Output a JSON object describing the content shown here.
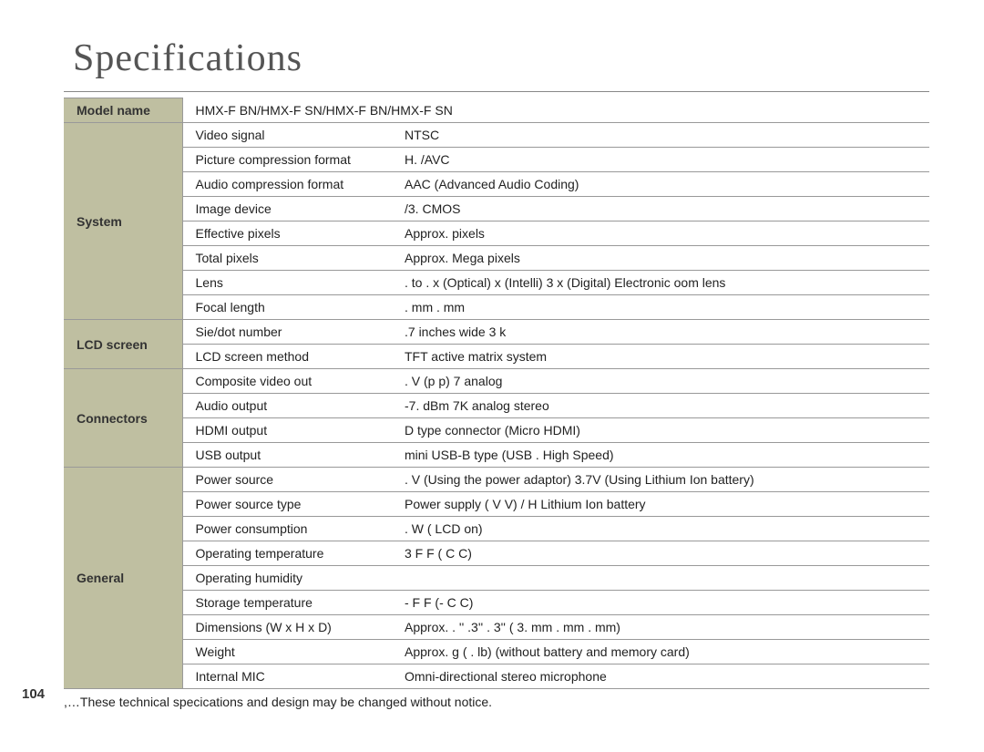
{
  "title": "Specifications",
  "page_number": "104",
  "footnote": ",…These technical specications and design may be changed without notice.",
  "model": {
    "cat": "Model name",
    "value": "HMX-F  BN/HMX-F  SN/HMX-F   BN/HMX-F   SN"
  },
  "sections": [
    {
      "cat": "System",
      "rows": [
        {
          "label": "Video signal",
          "value": "NTSC"
        },
        {
          "label": "Picture compression format",
          "value": "H.  /AVC"
        },
        {
          "label": "Audio compression format",
          "value": "AAC (Advanced Audio Coding)"
        },
        {
          "label": "Image device",
          "value": "/3.  CMOS"
        },
        {
          "label": "Effective pixels",
          "value": "Approx.        pixels"
        },
        {
          "label": "Total pixels",
          "value": "Approx.   Mega pixels"
        },
        {
          "label": "Lens",
          "value": ".  to  .   x (Optical)    x (Intelli)   3 x (Digital) Electronic oom lens"
        },
        {
          "label": "Focal length",
          "value": " . mm   . mm"
        }
      ]
    },
    {
      "cat": "LCD screen",
      "rows": [
        {
          "label": "Sie/dot number",
          "value": " .7 inches wide   3 k"
        },
        {
          "label": "LCD screen method",
          "value": "TFT active matrix system"
        }
      ]
    },
    {
      "cat": "Connectors",
      "rows": [
        {
          "label": "Composite video out",
          "value": " . V (p p)   7        analog"
        },
        {
          "label": "Audio output",
          "value": "-7. dBm  7K       analog  stereo"
        },
        {
          "label": "HDMI output",
          "value": "D type connector (Micro HDMI)"
        },
        {
          "label": "USB output",
          "value": "mini USB-B type (USB  .  High Speed)"
        }
      ]
    },
    {
      "cat": "General",
      "rows": [
        {
          "label": "Power source",
          "value": " . V (Using the power adaptor)  3.7V (Using Lithium Ion battery)"
        },
        {
          "label": "Power source type",
          "value": "Power supply (   V   V)   /  H   Lithium Ion battery"
        },
        {
          "label": "Power consumption",
          "value": " . W ( LCD on)"
        },
        {
          "label": "Operating temperature",
          "value": " 3 F    F ( C   C)"
        },
        {
          "label": "Operating humidity",
          "value": "                "
        },
        {
          "label": "Storage temperature",
          "value": "-  F    F (-   C   C)"
        },
        {
          "label": "Dimensions (W x H x D)",
          "value": " Approx.  .  ''  .3''   . 3'' ( 3. mm   . mm    . mm)"
        },
        {
          "label": "Weight",
          "value": "Approx.   g ( .  lb) (without battery and memory card)"
        },
        {
          "label": "Internal MIC",
          "value": "Omni-directional stereo microphone"
        }
      ]
    }
  ]
}
